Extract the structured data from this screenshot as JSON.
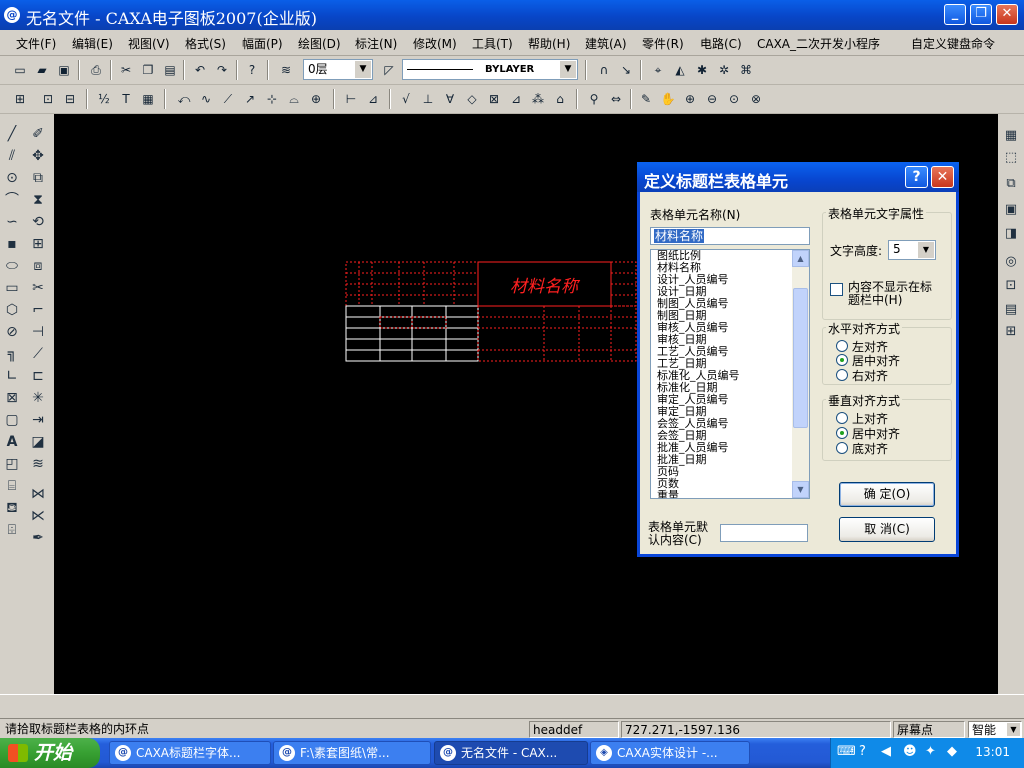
{
  "window": {
    "title": "无名文件 - CAXA电子图板2007(企业版)",
    "app_icon": "@",
    "minimize": "_",
    "maximize": "❐",
    "close": "✕"
  },
  "menu": [
    "文件(F)",
    "编辑(E)",
    "视图(V)",
    "格式(S)",
    "幅面(P)",
    "绘图(D)",
    "标注(N)",
    "修改(M)",
    "工具(T)",
    "帮助(H)",
    "建筑(A)",
    "零件(R)",
    "电路(C)",
    "CAXA_二次开发小程序",
    "自定义键盘命令"
  ],
  "toolbar": {
    "layer_value": "0层",
    "linetype_value": "BYLAYER"
  },
  "drawing": {
    "title_text": "材料名称"
  },
  "dialog": {
    "title": "定义标题栏表格单元",
    "help_btn": "?",
    "close_btn": "✕",
    "cell_name_label": "表格单元名称(N)",
    "cell_name_value": "材料名称",
    "list_items": [
      "图纸比例",
      "材料名称",
      "设计_人员编号",
      "设计_日期",
      "制图_人员编号",
      "制图_日期",
      "审核_人员编号",
      "审核_日期",
      "工艺_人员编号",
      "工艺_日期",
      "标准化_人员编号",
      "标准化_日期",
      "审定_人员编号",
      "审定_日期",
      "会签_人员编号",
      "会签_日期",
      "批准_人员编号",
      "批准_日期",
      "页码",
      "页数",
      "重量"
    ],
    "default_content_label_1": "表格单元默",
    "default_content_label_2": "认内容(C)",
    "text_props_group": "表格单元文字属性",
    "text_height_label": "文字高度:",
    "text_height_value": "5",
    "hide_text_label_1": "内容不显示在标",
    "hide_text_label_2": "题栏中(H)",
    "h_align_group": "水平对齐方式",
    "h_align_options": [
      "左对齐",
      "居中对齐",
      "右对齐"
    ],
    "h_align_selected": "居中对齐",
    "v_align_group": "垂直对齐方式",
    "v_align_options": [
      "上对齐",
      "居中对齐",
      "底对齐"
    ],
    "v_align_selected": "居中对齐",
    "ok_button": "确  定(O)",
    "cancel_button": "取  消(C)"
  },
  "status": {
    "prompt": "请拾取标题栏表格的内环点",
    "command": "headdef",
    "coords": "727.271,-1597.136",
    "snap_mode": "屏幕点",
    "smart": "智能"
  },
  "taskbar": {
    "start": "开始",
    "items": [
      "CAXA标题栏字体...",
      "F:\\素套图纸\\常...",
      "无名文件 - CAX...",
      "CAXA实体设计 -..."
    ],
    "active_index": 2,
    "clock": "13:01"
  },
  "colors": {
    "canvas": "#000000",
    "drawing_red": "#ff2020",
    "drawing_white": "#ffffff",
    "titlebar": "#0a46c8"
  }
}
